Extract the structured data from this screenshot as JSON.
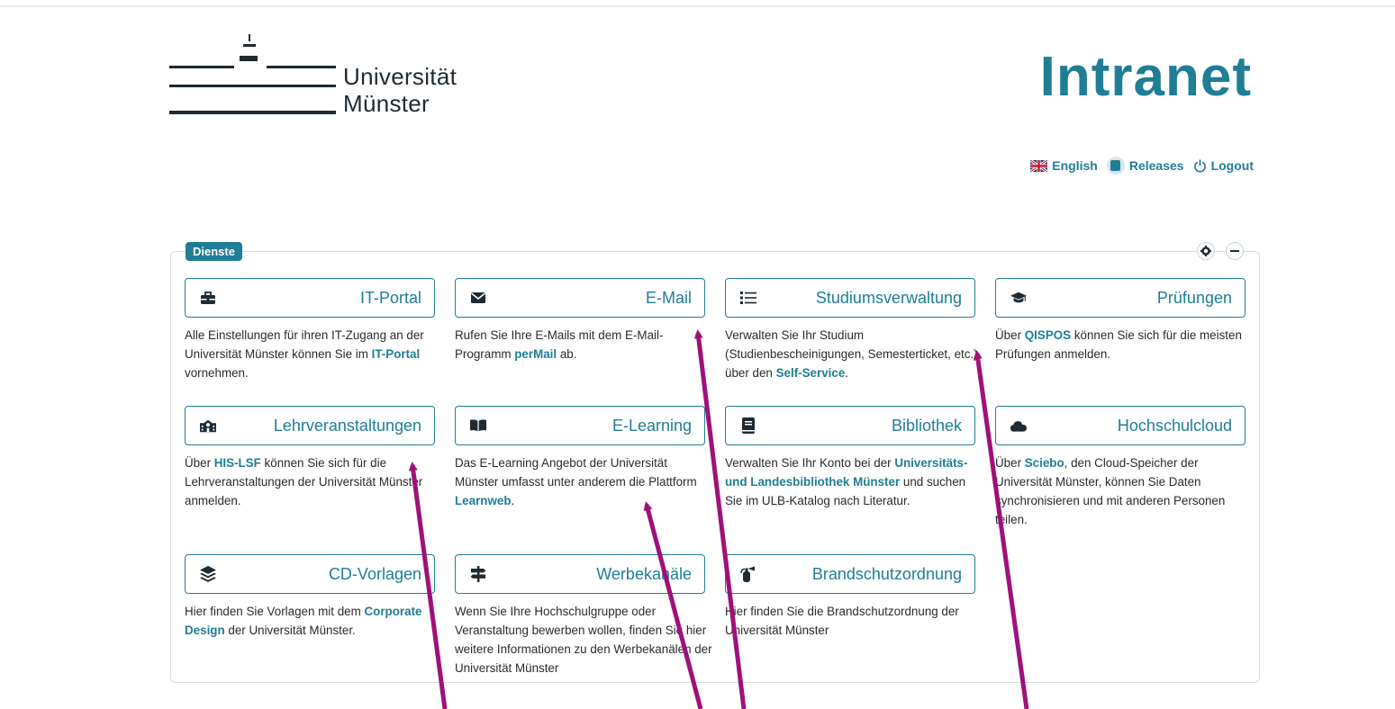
{
  "header": {
    "logo_line1": "Universität",
    "logo_line2": "Münster",
    "title": "Intranet"
  },
  "topnav": {
    "english": "English",
    "releases": "Releases",
    "logout": "Logout"
  },
  "panel": {
    "title": "Dienste"
  },
  "cards": [
    {
      "label": "IT-Portal",
      "icon": "toolbox-icon",
      "desc_a": "Alle Einstellungen für ihren IT-Zugang an der Universität Münster können Sie im ",
      "link": "IT-Portal",
      "desc_b": " vornehmen."
    },
    {
      "label": "E-Mail",
      "icon": "envelope-icon",
      "desc_a": "Rufen Sie Ihre E-Mails mit dem E-Mail-Programm ",
      "link": "perMail",
      "desc_b": " ab."
    },
    {
      "label": "Studiumsverwaltung",
      "icon": "list-icon",
      "desc_a": "Verwalten Sie Ihr Studium (Studienbescheinigungen, Semesterticket, etc.) über den ",
      "link": "Self-Service",
      "desc_b": "."
    },
    {
      "label": "Prüfungen",
      "icon": "graduation-cap-icon",
      "desc_a": "Über ",
      "link": "QISPOS",
      "desc_b": " können Sie sich für die meisten Prüfungen anmelden."
    },
    {
      "label": "Lehrveranstaltungen",
      "icon": "school-icon",
      "desc_a": "Über ",
      "link": "HIS-LSF",
      "desc_b": " können Sie sich für die Lehrveranstaltungen der Universität Münster anmelden."
    },
    {
      "label": "E-Learning",
      "icon": "book-open-icon",
      "desc_a": "Das E-Learning Angebot der Universität Münster umfasst unter anderem die Plattform ",
      "link": "Learnweb",
      "desc_b": "."
    },
    {
      "label": "Bibliothek",
      "icon": "book-icon",
      "desc_a": "Verwalten Sie Ihr Konto bei der ",
      "link": "Universitäts- und Landesbibliothek Münster",
      "desc_b": " und suchen Sie im ULB-Katalog nach Literatur."
    },
    {
      "label": "Hochschulcloud",
      "icon": "cloud-icon",
      "desc_a": "Über ",
      "link": "Sciebo",
      "desc_b": ", den Cloud-Speicher der Universität Münster, können Sie Daten synchronisieren und mit anderen Personen teilen."
    },
    {
      "label": "CD-Vorlagen",
      "icon": "layers-icon",
      "desc_a": "Hier finden Sie Vorlagen mit dem ",
      "link": "Corporate Design",
      "desc_b": " der Universität Münster."
    },
    {
      "label": "Werbekanäle",
      "icon": "signpost-icon",
      "desc_a": "Wenn Sie Ihre Hochschulgruppe oder Veranstaltung bewerben wollen, finden Sie hier weitere Informationen zu den Werbekanälen der Universität Münster",
      "link": "",
      "desc_b": ""
    },
    {
      "label": "Brandschutzordnung",
      "icon": "fire-extinguisher-icon",
      "desc_a": "Hier finden Sie die Brandschutzordnung der Universität Münster",
      "link": "",
      "desc_b": ""
    }
  ],
  "colors": {
    "accent": "#1f7d95",
    "arrow": "#a0107a"
  }
}
